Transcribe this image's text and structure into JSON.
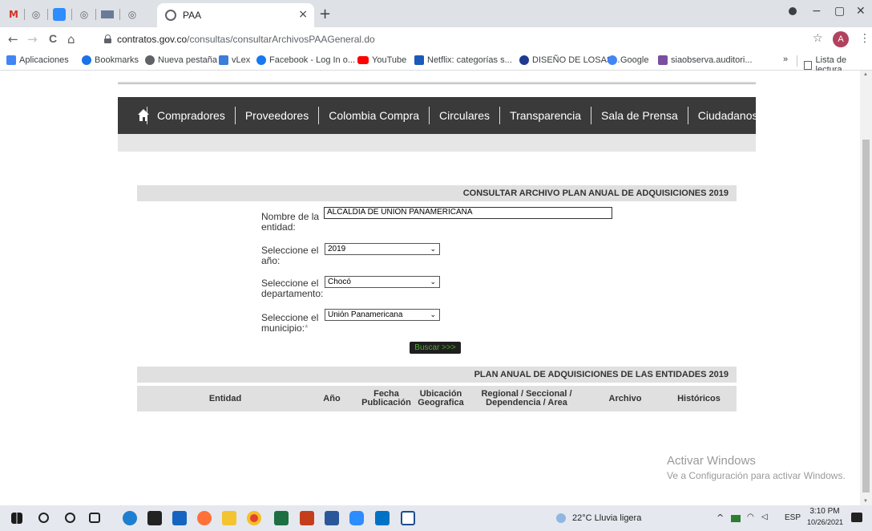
{
  "browser": {
    "tab_title": "PAA",
    "close_glyph": "×",
    "newtab_glyph": "+",
    "win_min": "−",
    "win_restore": "▢",
    "win_close": "✕",
    "nav_back": "←",
    "nav_forward": "→",
    "nav_reload": "C",
    "nav_home": "⌂",
    "url_host": "contratos.gov.co",
    "url_path": "/consultas/consultarArchivosPAAGeneral.do",
    "star": "☆",
    "avatar_letter": "A",
    "menu": "⋮",
    "bookmarks": [
      {
        "label": "Aplicaciones",
        "color": "#4285f4"
      },
      {
        "label": "Bookmarks",
        "color": "#1a73e8"
      },
      {
        "label": "Nueva pestaña",
        "color": "#5f6368"
      },
      {
        "label": "vLex",
        "color": "#3b7dd8"
      },
      {
        "label": "Facebook - Log In o...",
        "color": "#1877f2"
      },
      {
        "label": "YouTube",
        "color": "#ff0000"
      },
      {
        "label": "Netflix: categorías s...",
        "color": "#1a5ab8"
      },
      {
        "label": "DISEÑO DE LOSAS...",
        "color": "#1f3a93"
      },
      {
        "label": "Google",
        "color": "#4285f4"
      },
      {
        "label": "siaobserva.auditori...",
        "color": "#7b4fa0"
      }
    ],
    "bookmarks_more": "»",
    "reading_list": "Lista de lectura"
  },
  "site": {
    "nav": [
      "Compradores",
      "Proveedores",
      "Colombia Compra",
      "Circulares",
      "Transparencia",
      "Sala de Prensa",
      "Ciudadanos"
    ],
    "consult_title": "CONSULTAR ARCHIVO PLAN ANUAL DE ADQUISICIONES 2019",
    "form": {
      "entity_label_1": "Nombre de la",
      "entity_label_2": "entidad:",
      "entity_value": "ALCALDIA DE UNION PANAMERICANA",
      "year_label_1": "Seleccione el",
      "year_label_2": "año:",
      "year_value": "2019",
      "dept_label_1": "Seleccione el",
      "dept_label_2": "departamento:",
      "dept_value": "Chocó",
      "muni_label_1": "Seleccione el",
      "muni_label_2": "municipio:",
      "muni_value": "Unión Panamericana",
      "required_mark": "*",
      "caret": "⌄",
      "search_button": "Buscar >>>"
    },
    "plan_title": "PLAN ANUAL DE ADQUISICIONES DE LAS ENTIDADES 2019",
    "columns": [
      "Entidad",
      "Año",
      "Fecha Publicación",
      "Ubicación Geografica",
      "Regional / Seccional / Dependencia / Area",
      "Archivo",
      "Históricos"
    ]
  },
  "watermark": {
    "line1": "Activar Windows",
    "line2": "Ve a Configuración para activar Windows."
  },
  "taskbar": {
    "weather": "22°C  Lluvia ligera",
    "lang": "ESP",
    "time": "3:10 PM",
    "date": "10/26/2021",
    "chevron": "^"
  }
}
